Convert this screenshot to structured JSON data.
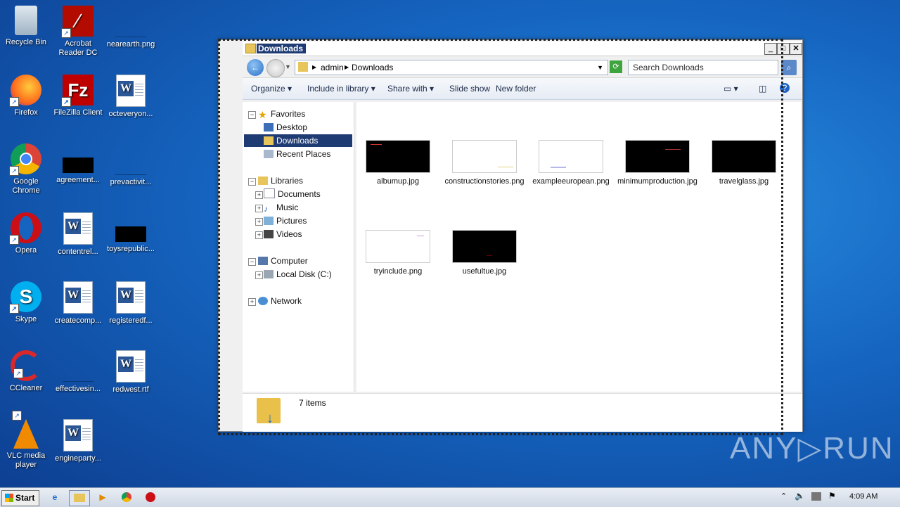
{
  "desktop": {
    "icons": [
      {
        "label": "Recycle Bin"
      },
      {
        "label": "Acrobat Reader DC"
      },
      {
        "label": "nearearth.png"
      },
      {
        "label": "Firefox"
      },
      {
        "label": "FileZilla Client"
      },
      {
        "label": "octeveryon..."
      },
      {
        "label": "Google Chrome"
      },
      {
        "label": "agreement..."
      },
      {
        "label": "prevactivit..."
      },
      {
        "label": "Opera"
      },
      {
        "label": "contentrel..."
      },
      {
        "label": "toysrepublic..."
      },
      {
        "label": "Skype"
      },
      {
        "label": "createcomp..."
      },
      {
        "label": "registeredf..."
      },
      {
        "label": "CCleaner"
      },
      {
        "label": "effectivesin..."
      },
      {
        "label": "redwest.rtf"
      },
      {
        "label": "VLC media player"
      },
      {
        "label": "engineparty..."
      }
    ]
  },
  "window": {
    "title": "Downloads",
    "address": {
      "part1": "admin",
      "part2": "Downloads"
    },
    "search_placeholder": "Search Downloads",
    "toolbar": {
      "organize": "Organize",
      "include": "Include in library",
      "share": "Share with",
      "slideshow": "Slide show",
      "newfolder": "New folder"
    },
    "nav": {
      "favorites": "Favorites",
      "desktop": "Desktop",
      "downloads": "Downloads",
      "recent": "Recent Places",
      "libraries": "Libraries",
      "documents": "Documents",
      "music": "Music",
      "pictures": "Pictures",
      "videos": "Videos",
      "computer": "Computer",
      "localdisk": "Local Disk (C:)",
      "network": "Network"
    },
    "files": [
      {
        "name": "albumup.jpg",
        "thumb": "#000000"
      },
      {
        "name": "constructionstories.png",
        "thumb": "#ffffff"
      },
      {
        "name": "exampleeuropean.png",
        "thumb": "#ffffff"
      },
      {
        "name": "minimumproduction.jpg",
        "thumb": "#000000"
      },
      {
        "name": "travelglass.jpg",
        "thumb": "#000000"
      },
      {
        "name": "tryinclude.png",
        "thumb": "#ffffff"
      },
      {
        "name": "usefultue.jpg",
        "thumb": "#000000"
      }
    ],
    "status": "7 items"
  },
  "taskbar": {
    "start": "Start",
    "clock": "4:09 AM"
  },
  "watermark": "ANY▷RUN"
}
